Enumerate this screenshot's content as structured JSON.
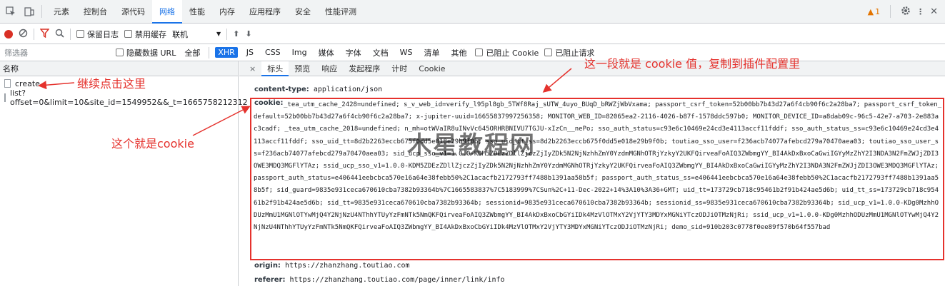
{
  "tabs": [
    "元素",
    "控制台",
    "源代码",
    "网络",
    "性能",
    "内存",
    "应用程序",
    "安全",
    "性能评测"
  ],
  "warnings": "1",
  "toolbar": {
    "preserve_log": "保留日志",
    "disable_cache": "禁用缓存",
    "throttle": "联机"
  },
  "filter": {
    "placeholder": "筛选器",
    "hide_data_url": "隐藏数据 URL",
    "types": [
      "全部",
      "XHR",
      "JS",
      "CSS",
      "Img",
      "媒体",
      "字体",
      "文档",
      "WS",
      "清单",
      "其他"
    ],
    "blocked_cookie": "已阻止 Cookie",
    "blocked_requests": "已阻止请求"
  },
  "left": {
    "header": "名称",
    "rows": [
      "create",
      "list?offset=0&limit=10&site_id=1549952&&_t=1665758212312"
    ],
    "annotation": "继续点击这里"
  },
  "right": {
    "close": "×",
    "tabs": [
      "标头",
      "预览",
      "响应",
      "发起程序",
      "计时",
      "Cookie"
    ],
    "content_type_key": "content-type:",
    "content_type_val": "application/json",
    "cookie_key": "cookie:",
    "cookie_val": "_tea_utm_cache_2428=undefined; s_v_web_id=verify_l95pl8gb_5TWf8Raj_sUTW_4uyo_BUqD_bRWZjWbVxama; passport_csrf_token=52b00bb7b43d27a6f4cb90f6c2a28ba7; passport_csrf_token_default=52b00bb7b43d27a6f4cb90f6c2a28ba7; x-jupiter-uuid=16655837997256358; MONITOR_WEB_ID=82065ea2-2116-4026-b87f-1578ddc597b0; MONITOR_DEVICE_ID=a8dab09c-96c5-42e7-a703-2e883ac3cadf; _tea_utm_cache_2018=undefined; n_mh=otWVaIR8uINvVc645ORHRBNIVU7TGJU-xIzCn__nePo; sso_auth_status=c93e6c10469e24cd3e4113accf11fddf; sso_auth_status_ss=c93e6c10469e24cd3e4113accf11fddf; sso_uid_tt=8d2b2263eccb675f0dd5e018e29b9f0b; sso_uid_tt_ss=8d2b2263eccb675f0dd5e018e29b9f0b; toutiao_sso_user=f236acb74077afebcd279a70470aea03; toutiao_sso_user_ss=f236acb74077afebcd279a70470aea03; sid_ucp_sso_v1=1.0.0-KDM5ZDEzZDllZjczZjIyZDk5N2NjNzhhZmY0YzdmMGNhOTRjYzkyY2UKFQirveaFoAIQ3ZWbmgYY_BI4AkDxBxoCaGwiIGYyMzZhY2I3NDA3N2FmZWJjZDI3OWE3MDQ3MGFlYTAz; ssid_ucp_sso_v1=1.0.0-KDM5ZDEzZDllZjczZjIyZDk5N2NjNzhhZmY0YzdmMGNhOTRjYzkyY2UKFQirveaFoAIQ3ZWbmgYY_BI4AkDxBxoCaGwiIGYyMzZhY2I3NDA3N2FmZWJjZDI3OWE3MDQ3MGFlYTAz; passport_auth_status=e406441eebcbca570e16a64e38febb50%2C1acacfb2172793ff7488b1391aa58b5f; passport_auth_status_ss=e406441eebcbca570e16a64e38febb50%2C1acacfb2172793ff7488b1391aa58b5f; sid_guard=9835e931ceca670610cba7382b93364b%7C1665583837%7C5183999%7CSun%2C+11-Dec-2022+14%3A10%3A36+GMT; uid_tt=173729cb718c95461b2f91b424ae5d6b; uid_tt_ss=173729cb718c95461b2f91b424ae5d6b; sid_tt=9835e931ceca670610cba7382b93364b; sessionid=9835e931ceca670610cba7382b93364b; sessionid_ss=9835e931ceca670610cba7382b93364b; sid_ucp_v1=1.0.0-KDg0MzhhODUzMmU1MGNlOTYwMjQ4Y2NjNzU4NThhYTUyYzFmNTk5NmQKFQirveaFoAIQ3ZWbmgYY_BI4AkDxBxoCbGYiIDk4MzVlOTMxY2VjYTY3MDYxMGNiYTczODJiOTMzNjRi; ssid_ucp_v1=1.0.0-KDg0MzhhODUzMmU1MGNlOTYwMjQ4Y2NjNzU4NThhYTUyYzFmNTk5NmQKFQirveaFoAIQ3ZWbmgYY_BI4AkDxBxoCbGYiIDk4MzVlOTMxY2VjYTY3MDYxMGNiYTczODJiOTMzNjRi; demo_sid=910b203c0778f0ee89f570b64f557bad",
    "origin_key": "origin:",
    "origin_val": "https://zhanzhang.toutiao.com",
    "referer_key": "referer:",
    "referer_val": "https://zhanzhang.toutiao.com/page/inner/link/info"
  },
  "annotations": {
    "cookie_value": "这一段就是 cookie 值，复制到插件配置里",
    "this_is_cookie": "这个就是cookie"
  },
  "watermark": "木星教程网",
  "colors": {
    "accent": "#1a73e8",
    "annotation": "#e5322d",
    "record": "#d93025"
  }
}
